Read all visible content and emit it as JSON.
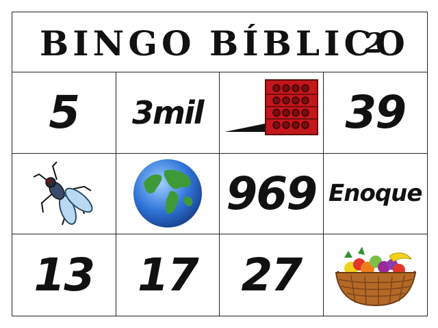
{
  "header": {
    "title_left": "BINGO",
    "title_right": "BÍBLICO",
    "card_number": "2"
  },
  "cells": [
    {
      "type": "text",
      "text": "5"
    },
    {
      "type": "text",
      "text": "3mil"
    },
    {
      "type": "icon",
      "icon": "brick-wall-icon"
    },
    {
      "type": "text",
      "text": "39"
    },
    {
      "type": "icon",
      "icon": "fly-icon"
    },
    {
      "type": "icon",
      "icon": "globe-icon"
    },
    {
      "type": "text",
      "text": "969"
    },
    {
      "type": "text",
      "text": "Enoque"
    },
    {
      "type": "text",
      "text": "13"
    },
    {
      "type": "text",
      "text": "17"
    },
    {
      "type": "text",
      "text": "27"
    },
    {
      "type": "icon",
      "icon": "fruit-basket-icon"
    }
  ]
}
